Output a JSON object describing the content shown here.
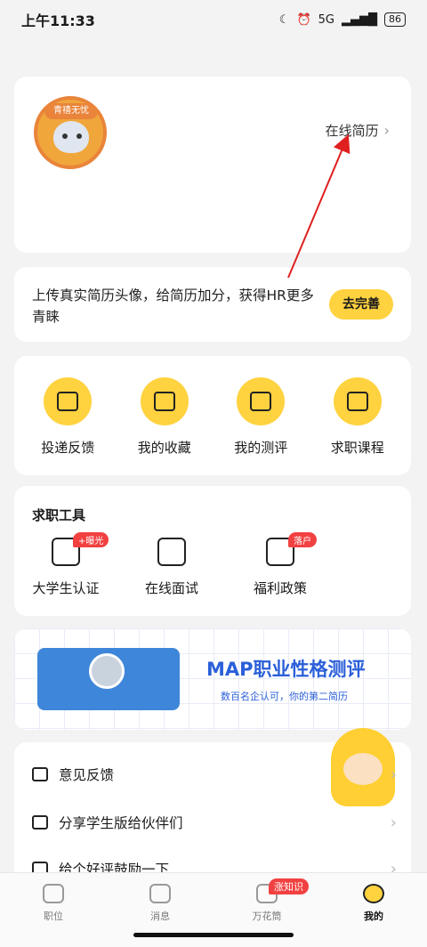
{
  "status_bar": {
    "time": "上午11:33",
    "network": "5G",
    "battery": "86"
  },
  "profile": {
    "avatar_badge": "青禧无忧",
    "resume_link": "在线简历"
  },
  "upload_tip": {
    "text": "上传真实简历头像，给简历加分，获得HR更多青睐",
    "button": "去完善"
  },
  "quick_actions": [
    {
      "label": "投递反馈",
      "icon": "envelope-icon"
    },
    {
      "label": "我的收藏",
      "icon": "folder-icon"
    },
    {
      "label": "我的测评",
      "icon": "clipboard-check-icon"
    },
    {
      "label": "求职课程",
      "icon": "book-icon"
    }
  ],
  "tools": {
    "title": "求职工具",
    "items": [
      {
        "label": "大学生认证",
        "badge": "+曝光",
        "icon": "graduation-cap-icon"
      },
      {
        "label": "在线面试",
        "badge": "",
        "icon": "video-envelope-icon"
      },
      {
        "label": "福利政策",
        "badge": "落户",
        "icon": "star-document-icon"
      }
    ]
  },
  "banner": {
    "title": "MAP职业性格测评",
    "subtitle": "数百名企认可，你的第二简历"
  },
  "settings": [
    {
      "label": "意见反馈",
      "icon": "feedback-icon"
    },
    {
      "label": "分享学生版给伙伴们",
      "icon": "share-icon"
    },
    {
      "label": "给个好评鼓励一下",
      "icon": "thumbs-up-icon"
    }
  ],
  "tabbar": [
    {
      "label": "职位",
      "icon": "briefcase-icon",
      "badge": ""
    },
    {
      "label": "消息",
      "icon": "chat-icon",
      "badge": ""
    },
    {
      "label": "万花筒",
      "icon": "kaleidoscope-icon",
      "badge": "涨知识"
    },
    {
      "label": "我的",
      "icon": "profile-face-icon",
      "badge": "",
      "active": true
    }
  ],
  "colors": {
    "accent": "#ffd23f",
    "badge_red": "#f24141",
    "banner_blue": "#2b5fd9",
    "annotation_arrow": "#e02020"
  }
}
